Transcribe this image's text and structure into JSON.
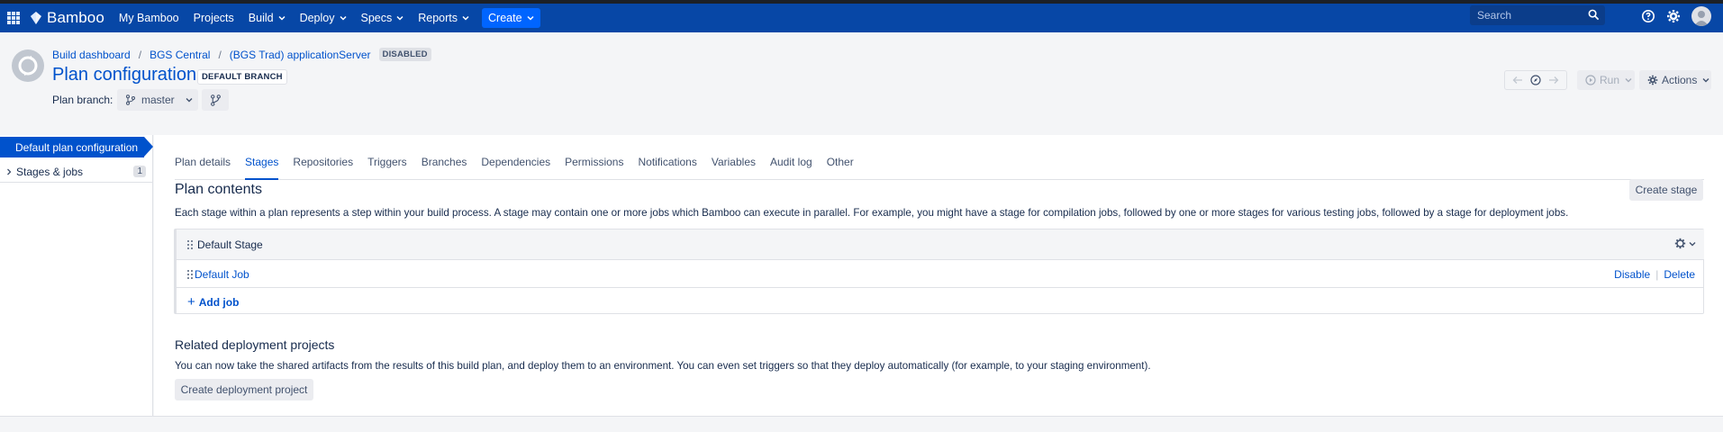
{
  "app": {
    "name": "Bamboo"
  },
  "topnav": {
    "items": [
      {
        "label": "My Bamboo",
        "dropdown": false
      },
      {
        "label": "Projects",
        "dropdown": false
      },
      {
        "label": "Build",
        "dropdown": true
      },
      {
        "label": "Deploy",
        "dropdown": true
      },
      {
        "label": "Specs",
        "dropdown": true
      },
      {
        "label": "Reports",
        "dropdown": true
      }
    ],
    "create_label": "Create",
    "search_placeholder": "Search",
    "icons": [
      "app-switcher-icon",
      "help-icon",
      "settings-icon",
      "avatar"
    ]
  },
  "header": {
    "breadcrumbs": [
      "Build dashboard",
      "BGS Central",
      "(BGS Trad) applicationServer"
    ],
    "status_lozenge": "DISABLED",
    "title": "Plan configuration",
    "branch_lozenge": "DEFAULT BRANCH",
    "plan_branch_label": "Plan branch:",
    "plan_branch_value": "master",
    "run_label": "Run",
    "actions_label": "Actions"
  },
  "sidebar": {
    "active_item": "Default plan configuration",
    "items": [
      {
        "label": "Stages & jobs",
        "count": "1"
      }
    ]
  },
  "tabs": [
    {
      "label": "Plan details",
      "active": false
    },
    {
      "label": "Stages",
      "active": true
    },
    {
      "label": "Repositories",
      "active": false
    },
    {
      "label": "Triggers",
      "active": false
    },
    {
      "label": "Branches",
      "active": false
    },
    {
      "label": "Dependencies",
      "active": false
    },
    {
      "label": "Permissions",
      "active": false
    },
    {
      "label": "Notifications",
      "active": false
    },
    {
      "label": "Variables",
      "active": false
    },
    {
      "label": "Audit log",
      "active": false
    },
    {
      "label": "Other",
      "active": false
    }
  ],
  "plan_contents": {
    "title": "Plan contents",
    "create_stage_label": "Create stage",
    "description": "Each stage within a plan represents a step within your build process. A stage may contain one or more jobs which Bamboo can execute in parallel. For example, you might have a stage for compilation jobs, followed by one or more stages for various testing jobs, followed by a stage for deployment jobs.",
    "stage": {
      "name": "Default Stage",
      "jobs": [
        {
          "name": "Default Job",
          "disable_label": "Disable",
          "delete_label": "Delete"
        }
      ],
      "add_job_label": "Add job"
    }
  },
  "related": {
    "title": "Related deployment projects",
    "text": "You can now take the shared artifacts from the results of this build plan, and deploy them to an environment. You can even set triggers so that they deploy automatically (for example, to your staging environment).",
    "button_label": "Create deployment project"
  },
  "colors": {
    "nav_bg": "#0747a6",
    "link": "#0052cc",
    "create_button": "#0065ff",
    "page_bg": "#f4f5f7"
  }
}
